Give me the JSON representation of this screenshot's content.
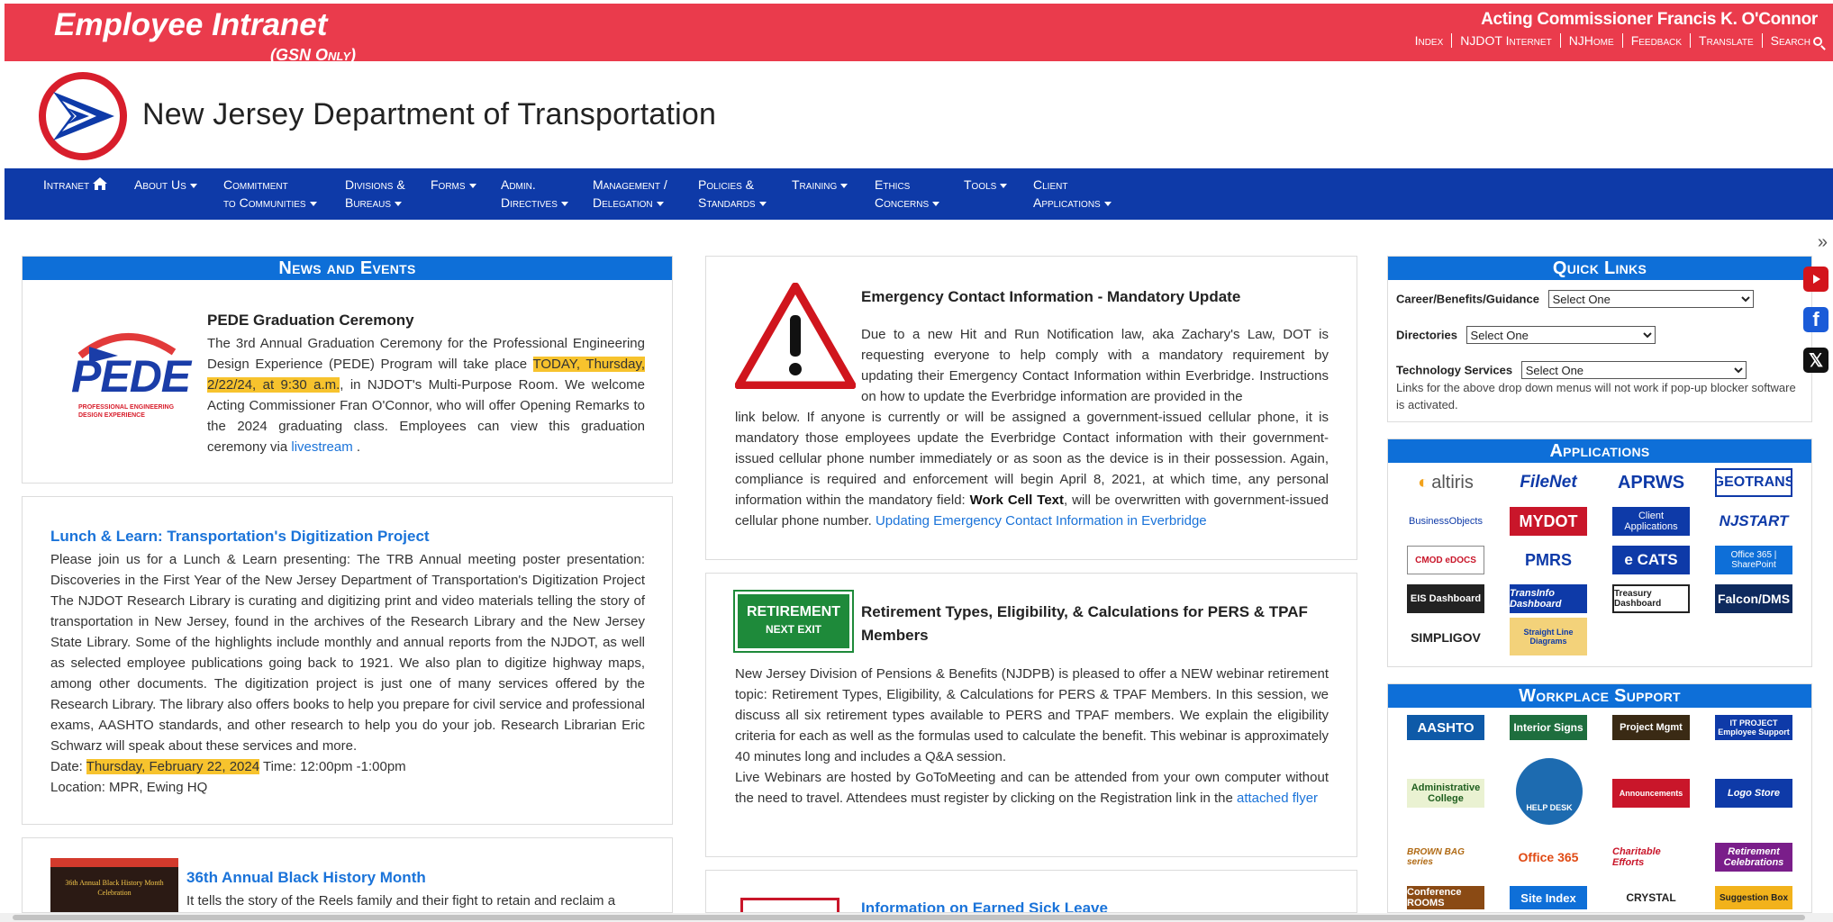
{
  "topbar": {
    "brand": "Employee Intranet",
    "gsn": "(GSN Only)",
    "commissioner": "Acting Commissioner Francis K. O'Connor",
    "links": [
      "Index",
      "NJDOT Internet",
      "NJHome",
      "Feedback",
      "Translate",
      "Search"
    ]
  },
  "header": {
    "title": "New Jersey Department of Transportation",
    "logo_icon": "njdot-seal-logo"
  },
  "nav": {
    "items": [
      {
        "l1": "Intranet",
        "l2": ""
      },
      {
        "l1": "About Us",
        "l2": ""
      },
      {
        "l1": "Commitment",
        "l2": "to Communities"
      },
      {
        "l1": "Divisions &",
        "l2": "Bureaus"
      },
      {
        "l1": "Forms",
        "l2": ""
      },
      {
        "l1": "Admin.",
        "l2": "Directives"
      },
      {
        "l1": "Management /",
        "l2": "Delegation"
      },
      {
        "l1": "Policies &",
        "l2": "Standards"
      },
      {
        "l1": "Training",
        "l2": ""
      },
      {
        "l1": "Ethics",
        "l2": "Concerns"
      },
      {
        "l1": "Tools",
        "l2": ""
      },
      {
        "l1": "Client",
        "l2": "Applications"
      }
    ]
  },
  "news": {
    "heading": "News and Events",
    "pede": {
      "logo_text": "PEDE",
      "logo_sub": "PROFESSIONAL ENGINEERING DESIGN EXPERIENCE",
      "title": "PEDE Graduation Ceremony",
      "p1": "The 3rd Annual Graduation Ceremony for the Professional Engineering Design Experience (PEDE) Program will take place ",
      "highlight": "TODAY, Thursday, 2/22/24, at 9:30 a.m.",
      "p2": ", in NJDOT's Multi-Purpose Room. We welcome Acting Commissioner Fran O'Connor, who will offer Opening Remarks to the 2024 graduating class. Employees can view this graduation ceremony via ",
      "link": "livestream",
      "end": " ."
    },
    "lunch": {
      "title": "Lunch & Learn: Transportation's Digitization Project",
      "body": "Please join us for a Lunch & Learn presenting: The TRB Annual meeting poster presentation: Discoveries in the First Year of the New Jersey Department of Transportation's Digitization Project The NJDOT Research Library is curating and digitizing print and video materials telling the story of transportation in New Jersey, found in the archives of the Research Library and the New Jersey State Library. Some of the highlights include monthly and annual reports from the NJDOT, as well as selected employee publications going back to 1921. We also plan to digitize highway maps, among other documents. The digitization project is just one of many services offered by the Research Library. The library also offers books to help you prepare for civil service and professional exams, AASHTO standards, and other research to help you do your job. Research Librarian Eric Schwarz will speak about these services and more.",
      "date_label": "Date: ",
      "date_value": "Thursday, February 22, 2024",
      "time": " Time: 12:00pm -1:00pm",
      "location": "Location: MPR, Ewing HQ"
    },
    "bhm": {
      "title": "36th Annual Black History Month",
      "thumb_text": "36th Annual Black History Month Celebration",
      "body": "It tells the story of the Reels family and their fight to retain and reclaim a"
    }
  },
  "emergency": {
    "title": "Emergency Contact Information - Mandatory Update",
    "p_top": "Due to a new Hit and Run Notification law, aka Zachary's Law, DOT is requesting everyone to help comply with a mandatory requirement by updating their Emergency Contact Information within Everbridge. Instructions on how to update the Everbridge information are provided in the",
    "p_rest": "link below. If anyone is currently or will be assigned a government-issued cellular phone, it is mandatory those employees update the Everbridge Contact information with their government-issued cellular phone number immediately or as soon as the device is in their possession. Again, compliance is required and enforcement will begin April 8, 2021, at which time, any personal information within the mandatory field: ",
    "bold": "Work Cell Text",
    "p_end": ", will be overwritten with government-issued cellular phone number. ",
    "link": "Updating Emergency Contact Information in Everbridge"
  },
  "retirement": {
    "sign_l1": "RETIREMENT",
    "sign_l2": "NEXT EXIT",
    "title": "Retirement Types, Eligibility, & Calculations for PERS & TPAF Members",
    "p1": "New Jersey Division of Pensions & Benefits (NJDPB) is pleased to offer a NEW webinar retirement topic: Retirement Types, Eligibility, & Calculations for PERS & TPAF Members. In this session, we discuss all six retirement types available to PERS and TPAF members. We explain the eligibility criteria for each as well as the formulas used to calculate the benefit. This webinar is approximately 40 minutes long and includes a Q&A session.",
    "p2": "Live Webinars are hosted by GoToMeeting and can be attended from your own computer without the need to travel. Attendees must register by clicking on the Registration link in the ",
    "link": "attached flyer"
  },
  "sick_leave": {
    "title": "Information on Earned Sick Leave"
  },
  "quick_links": {
    "heading": "Quick Links",
    "career_label": "Career/Benefits/Guidance",
    "directories_label": "Directories",
    "tech_label": "Technology Services",
    "select_value": "Select One",
    "note": "Links for the above drop down menus will not work if pop-up blocker software is activated."
  },
  "applications": {
    "heading": "Applications",
    "tiles": [
      "altiris",
      "FileNet",
      "APRWS",
      "GEOTRANS",
      "BusinessObjects",
      "MYDOT",
      "Client Applications",
      "NJSTART",
      "CMOD eDOCS",
      "PMRS",
      "e CATS",
      "Office 365 | SharePoint",
      "EIS Dashboard",
      "TransInfo Dashboard",
      "Treasury Dashboard",
      "Falcon/DMS",
      "SIMPLIGOV",
      "Straight Line Diagrams"
    ]
  },
  "workplace": {
    "heading": "Workplace Support",
    "tiles": [
      "AASHTO",
      "Interior Signs",
      "Project Mgmt",
      "IT PROJECT Employee Support",
      "Administrative College",
      "HELP DESK",
      "Announcements",
      "Logo Store",
      "BROWN BAG series",
      "Office 365",
      "Charitable Efforts",
      "Retirement Celebrations",
      "Conference ROOMS",
      "Site Index",
      "CRYSTAL",
      "Suggestion Box"
    ]
  },
  "social": {
    "toggle": "»",
    "icons": [
      "youtube-icon",
      "facebook-icon",
      "x-icon"
    ]
  },
  "colors": {
    "topbar": "#ea3b4c",
    "nav": "#0e3aa8",
    "panel_head": "#0e6fd8",
    "highlight": "#f7c32d",
    "link": "#1a73d9"
  }
}
